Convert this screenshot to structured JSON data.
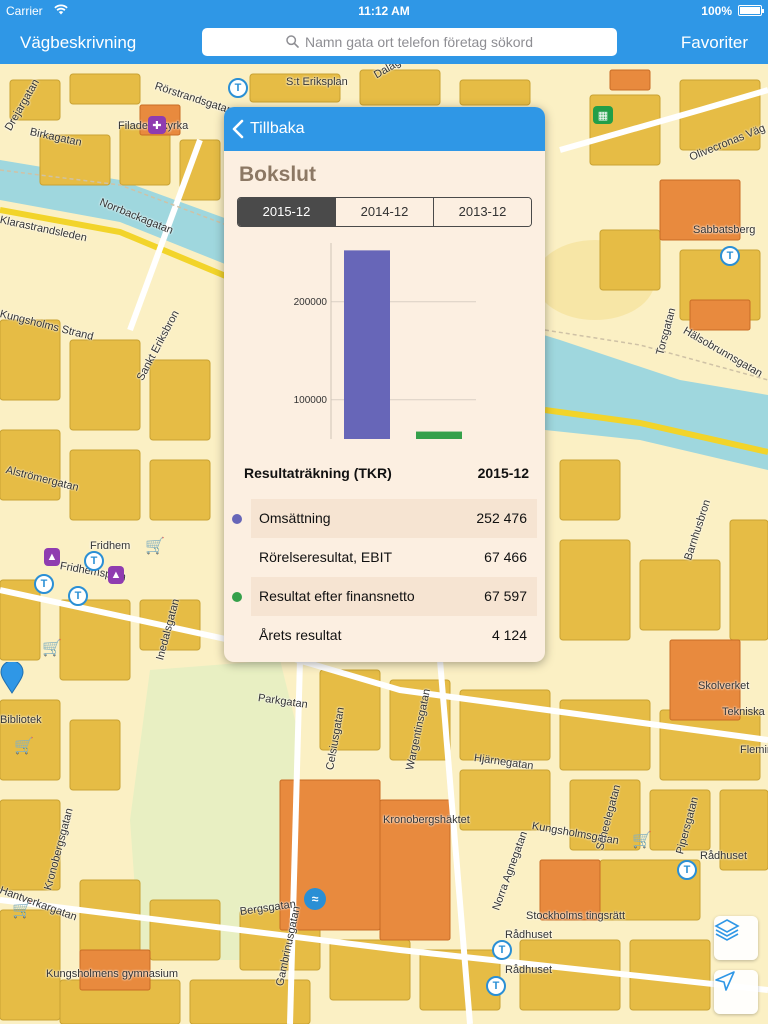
{
  "status_bar": {
    "carrier": "Carrier",
    "time": "11:12 AM",
    "battery": "100%"
  },
  "nav": {
    "left_label": "Vägbeskrivning",
    "search_placeholder": "Namn gata ort telefon företag sökord",
    "right_label": "Favoriter"
  },
  "map_labels": [
    "Rörstrandsgatan",
    "S:t Eriksplan",
    "Dalagatan",
    "Birkagatan",
    "Filadelfiakyrka",
    "Drejargatan",
    "Olivecronas Väg",
    "Sabbatsberg",
    "Norrbackagatan",
    "Klarastrandsleden",
    "Kungsholms Strand",
    "Sankt Eriksbron",
    "Hälsobrunnsgatan",
    "Torsgatan",
    "Alströmergatan",
    "Fridhem",
    "Fridhemsplan",
    "Inedalsgatan",
    "Parkgatan",
    "Celsiusgatan",
    "Wargentinsgatan",
    "Hjärnegatan",
    "Barnhusbron",
    "Skolverket",
    "Tekniska",
    "Fleminggatan",
    "Kronobergshäktet",
    "Kungsholmsgatan",
    "Scheelegatan",
    "Pipersgatan",
    "Rådhuset",
    "Kronobergsgatan",
    "Norra Agnegatan",
    "Stockholms tingsrätt",
    "Bergsgatan",
    "Gambrinusgatan",
    "Hantverkargatan",
    "Kungsholmens gymnasium",
    "Bibliotek"
  ],
  "map_icons": {
    "metro": "metro-icon",
    "shop": "cart-icon",
    "store": "bag-icon",
    "church": "church-icon",
    "museum": "museum-icon",
    "swim": "swim-icon",
    "pin": "location-pin-icon",
    "layers": "layers-icon",
    "locate": "location-arrow-icon"
  },
  "metro_marker_letter": "T",
  "popover": {
    "back_label": "Tillbaka",
    "title": "Bokslut",
    "segments": [
      {
        "label": "2015-12",
        "selected": true
      },
      {
        "label": "2014-12",
        "selected": false
      },
      {
        "label": "2013-12",
        "selected": false
      }
    ],
    "table": {
      "heading": "Resultaträkning (TKR)",
      "period": "2015-12",
      "rows": [
        {
          "label": "Omsättning",
          "value": "252 476",
          "marker": "#6766b8"
        },
        {
          "label": "Rörelseresultat, EBIT",
          "value": "67 466",
          "marker": null
        },
        {
          "label": "Resultat efter finansnetto",
          "value": "67 597",
          "marker": "#35a04a"
        },
        {
          "label": "Årets resultat",
          "value": "4 124",
          "marker": null
        }
      ]
    }
  },
  "chart_data": {
    "type": "bar",
    "categories": [
      "Omsättning",
      "Resultat efter finansnetto"
    ],
    "values": [
      252476,
      67597
    ],
    "colors": [
      "#6766b8",
      "#35a04a"
    ],
    "ylim": [
      0,
      260000
    ],
    "visible_ylim": [
      60000,
      260000
    ],
    "yticks": [
      100000,
      200000
    ],
    "ytick_labels": [
      "100000",
      "200000"
    ],
    "grid": true,
    "title": "",
    "xlabel": "",
    "ylabel": ""
  },
  "colors": {
    "accent": "#2f97e6",
    "popover_bg": "#fcefe1",
    "title": "#8c7864"
  }
}
